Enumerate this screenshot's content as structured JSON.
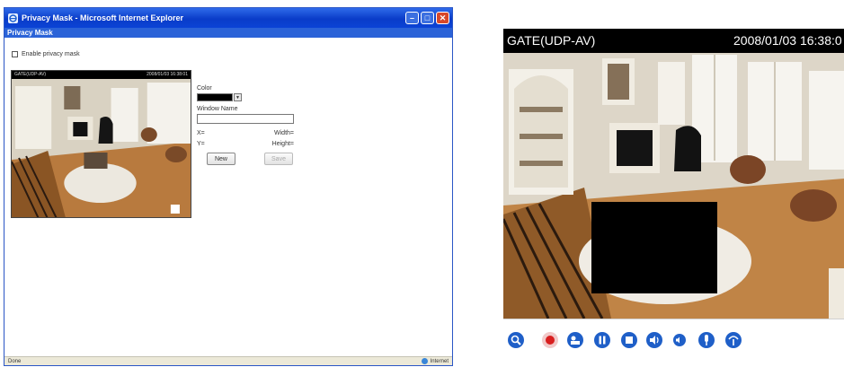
{
  "ie_window": {
    "title": "Privacy Mask - Microsoft Internet Explorer",
    "heading": "Privacy Mask",
    "enable_mask_label": "Enable privacy mask",
    "preview": {
      "camera_name": "GATE(UDP-AV)",
      "timestamp": "2008/01/03 16:38:01"
    },
    "form": {
      "color_label": "Color",
      "window_name_label": "Window Name",
      "window_name_value": "",
      "x_label": "X=",
      "y_label": "Y=",
      "width_label": "Width=",
      "height_label": "Height=",
      "new_button": "New",
      "save_button": "Save"
    },
    "status": {
      "left": "Done",
      "right": "Internet"
    },
    "icons": [
      "ie-icon",
      "minimize-icon",
      "maximize-icon",
      "close-icon",
      "globe-icon"
    ]
  },
  "camera_view": {
    "camera_name": "GATE(UDP-AV)",
    "timestamp": "2008/01/03 16:38:0",
    "mask_color": "#000000",
    "toolbar_icons": [
      "zoom-icon",
      "record-icon",
      "snapshot-icon",
      "pause-icon",
      "stop-icon",
      "volume-icon",
      "mute-icon",
      "talk-icon",
      "speaker-icon"
    ]
  },
  "colors": {
    "title_blue": "#0a3cc8",
    "heading_blue": "#2b63d8",
    "toolbar_icon_blue": "#1f5fc8",
    "record_red": "#d81e1e"
  }
}
